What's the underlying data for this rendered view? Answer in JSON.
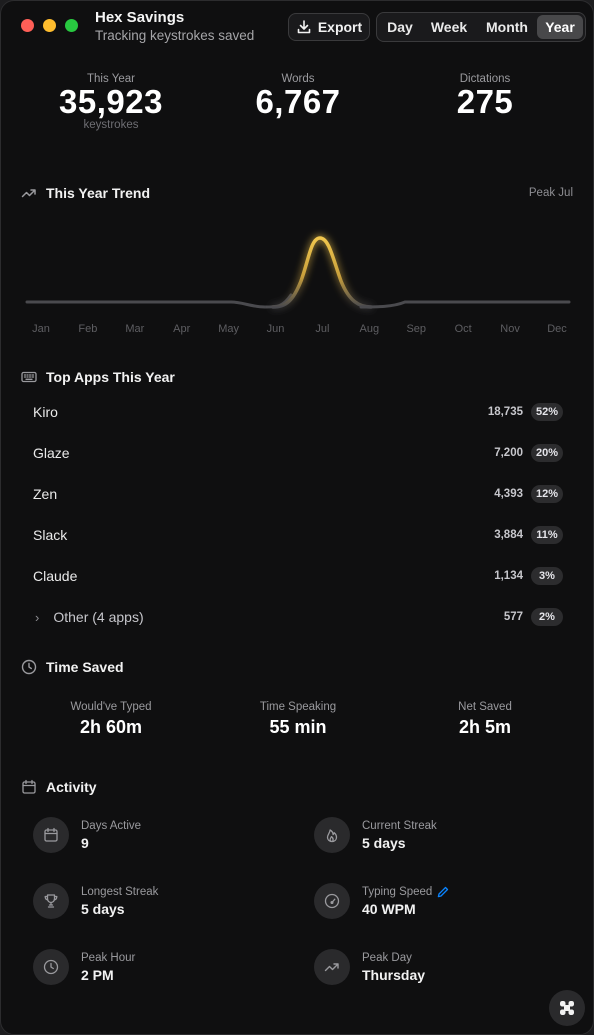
{
  "window": {
    "title": "Hex Savings",
    "subtitle": "Tracking keystrokes saved"
  },
  "toolbar": {
    "export_label": "Export",
    "periods": [
      "Day",
      "Week",
      "Month",
      "Year"
    ],
    "selected_period": "Year"
  },
  "stats": {
    "keystrokes": {
      "label": "This Year",
      "value": "35,923",
      "unit": "keystrokes"
    },
    "words": {
      "label": "Words",
      "value": "6,767"
    },
    "dictations": {
      "label": "Dictations",
      "value": "275"
    }
  },
  "trend": {
    "title": "This Year Trend",
    "peak_label": "Peak Jul",
    "months": [
      "Jan",
      "Feb",
      "Mar",
      "Apr",
      "May",
      "Jun",
      "Jul",
      "Aug",
      "Sep",
      "Oct",
      "Nov",
      "Dec"
    ],
    "highlight_color": "#e5b84a",
    "line_color": "#4a4a4e"
  },
  "top_apps": {
    "title": "Top Apps This Year",
    "items": [
      {
        "name": "Kiro",
        "count": "18,735",
        "percent": "52%"
      },
      {
        "name": "Glaze",
        "count": "7,200",
        "percent": "20%"
      },
      {
        "name": "Zen",
        "count": "4,393",
        "percent": "12%"
      },
      {
        "name": "Slack",
        "count": "3,884",
        "percent": "11%"
      },
      {
        "name": "Claude",
        "count": "1,134",
        "percent": "3%"
      }
    ],
    "other": {
      "name": "Other (4 apps)",
      "count": "577",
      "percent": "2%"
    }
  },
  "time_saved": {
    "title": "Time Saved",
    "typed": {
      "label": "Would've Typed",
      "value": "2h 60m"
    },
    "speaking": {
      "label": "Time Speaking",
      "value": "55 min"
    },
    "net": {
      "label": "Net Saved",
      "value": "2h 5m"
    }
  },
  "activity": {
    "title": "Activity",
    "days_active": {
      "label": "Days Active",
      "value": "9"
    },
    "current_streak": {
      "label": "Current Streak",
      "value": "5 days"
    },
    "longest_streak": {
      "label": "Longest Streak",
      "value": "5 days"
    },
    "typing_speed": {
      "label": "Typing Speed",
      "value": "40 WPM"
    },
    "peak_hour": {
      "label": "Peak Hour",
      "value": "2 PM"
    },
    "peak_day": {
      "label": "Peak Day",
      "value": "Thursday"
    }
  },
  "accent_color": "#0a84ff"
}
